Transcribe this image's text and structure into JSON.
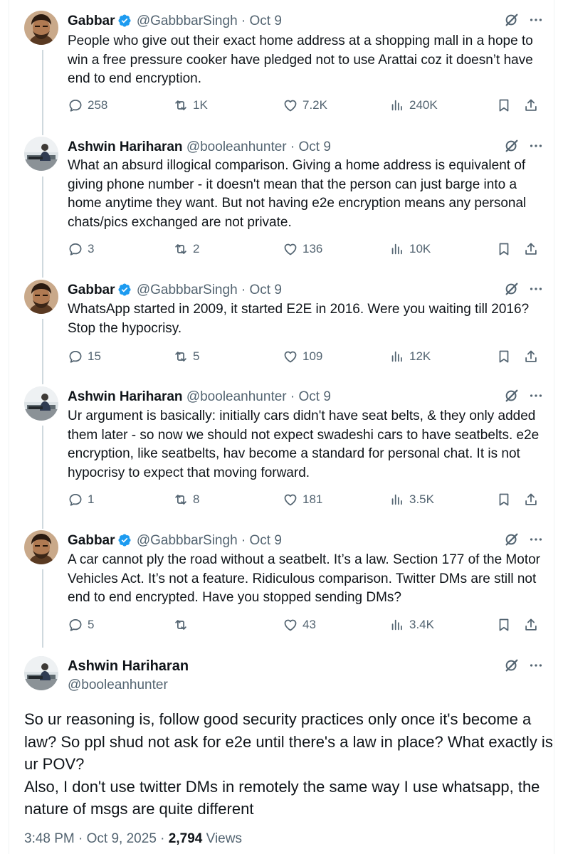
{
  "tweets": [
    {
      "name": "Gabbar",
      "verified": true,
      "handle": "@GabbbarSingh",
      "sep": "·",
      "date": "Oct 9",
      "text": "People who give out their exact home address at a shopping mall in a hope to win a free pressure cooker have pledged not to use Arattai coz it doesn’t have end to end encryption.",
      "replies": "258",
      "reposts": "1K",
      "likes": "7.2K",
      "views": "240K"
    },
    {
      "name": "Ashwin Hariharan",
      "verified": false,
      "handle": "@booleanhunter",
      "sep": "·",
      "date": "Oct 9",
      "text": "What an absurd illogical comparison. Giving a home address is equivalent of giving phone number - it doesn't mean that the person can just barge into a home anytime they want. But not having e2e encryption means any personal chats/pics exchanged are not private.",
      "replies": "3",
      "reposts": "2",
      "likes": "136",
      "views": "10K"
    },
    {
      "name": "Gabbar",
      "verified": true,
      "handle": "@GabbbarSingh",
      "sep": "·",
      "date": "Oct 9",
      "text": "WhatsApp started in 2009, it started E2E in 2016. Were you waiting till 2016? Stop the hypocrisy.",
      "replies": "15",
      "reposts": "5",
      "likes": "109",
      "views": "12K"
    },
    {
      "name": "Ashwin Hariharan",
      "verified": false,
      "handle": "@booleanhunter",
      "sep": "·",
      "date": "Oct 9",
      "text": "Ur argument is basically: initially cars didn't have seat belts, & they only added them later - so now we should not expect swadeshi cars to have seatbelts. e2e encryption, like seatbelts, hav become a standard for personal chat. It is not hypocrisy to expect that moving forward.",
      "replies": "1",
      "reposts": "8",
      "likes": "181",
      "views": "3.5K"
    },
    {
      "name": "Gabbar",
      "verified": true,
      "handle": "@GabbbarSingh",
      "sep": "·",
      "date": "Oct 9",
      "text": "A car cannot ply the road without a seatbelt. It’s a law. Section 177 of the Motor Vehicles Act. It’s not a feature. Ridiculous comparison. Twitter DMs are still not end to end encrypted. Have you stopped sending DMs?",
      "replies": "5",
      "reposts": "",
      "likes": "43",
      "views": "3.4K"
    }
  ],
  "main_tweet": {
    "name": "Ashwin Hariharan",
    "handle": "@booleanhunter",
    "text_lines": [
      "So ur reasoning is, follow good security practices only once it's become a law?  So ppl shud not ask for e2e until there's a law in place? What exactly is ur POV?",
      "Also, I don't use twitter DMs in remotely the same way I use whatsapp, the nature of msgs are quite different"
    ],
    "time": "3:48 PM",
    "sep1": "·",
    "date": "Oct 9, 2025",
    "sep2": "·",
    "views_count": "2,794",
    "views_label": "Views"
  },
  "colors": {
    "text": "#0f1419",
    "secondary": "#536471",
    "verified": "#1d9bf0",
    "thread_line": "#cfd9de"
  },
  "icons": [
    "verified-badge-icon",
    "grok-icon",
    "more-icon",
    "reply-icon",
    "repost-icon",
    "like-icon",
    "views-icon",
    "bookmark-icon",
    "share-icon"
  ]
}
